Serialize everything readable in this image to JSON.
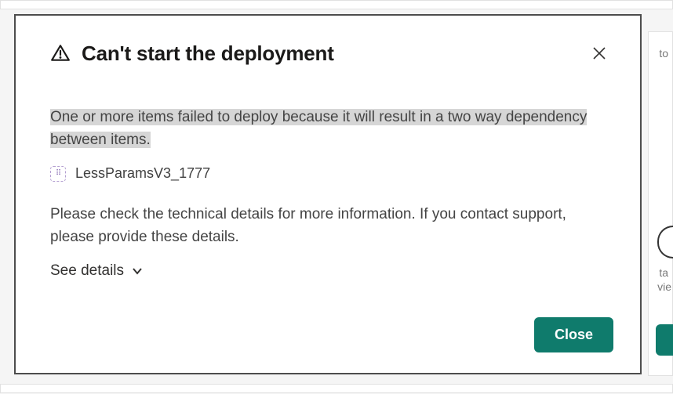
{
  "dialog": {
    "title": "Can't start the deployment",
    "error_message": "One or more items failed to deploy because it will result in a two way dependency between items.",
    "failed_item": "LessParamsV3_1777",
    "hint": "Please check the technical details for more information. If you contact support, please provide these details.",
    "see_details_label": "See details",
    "close_label": "Close"
  },
  "background_fragments": {
    "f1": "to",
    "f2": "ta",
    "f3": "vie"
  }
}
